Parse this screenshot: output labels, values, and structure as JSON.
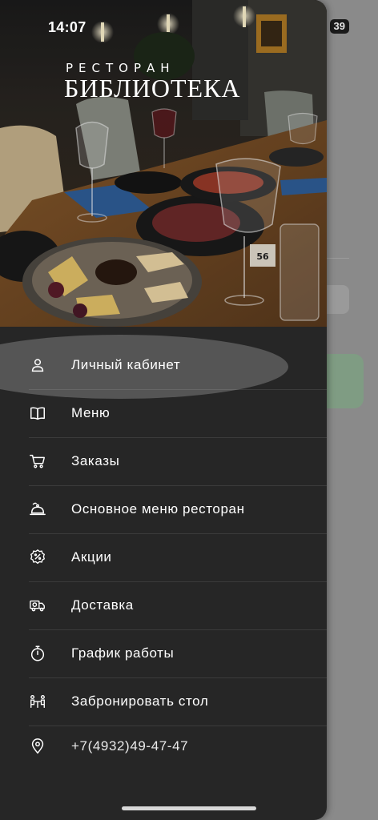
{
  "status_bar": {
    "time": "14:07",
    "battery": "39"
  },
  "logo": {
    "subtitle": "РЕСТОРАН",
    "title": "БИБЛИОТЕКА"
  },
  "menu": {
    "items": [
      {
        "label": "Личный кабинет",
        "icon": "person-icon"
      },
      {
        "label": "Меню",
        "icon": "book-icon"
      },
      {
        "label": "Заказы",
        "icon": "cart-icon"
      },
      {
        "label": "Основное меню ресторан",
        "icon": "cloche-icon"
      },
      {
        "label": "Акции",
        "icon": "percent-badge-icon"
      },
      {
        "label": "Доставка",
        "icon": "delivery-truck-icon"
      },
      {
        "label": "График работы",
        "icon": "stopwatch-icon"
      },
      {
        "label": "Забронировать стол",
        "icon": "table-reservation-icon"
      },
      {
        "label": "+7(4932)49-47-47",
        "icon": "location-pin-icon"
      }
    ]
  },
  "colors": {
    "drawer_bg": "#262626",
    "overlay_bg": "#8a8a8a",
    "accent_green": "#7f9c83",
    "text": "#ffffff"
  }
}
